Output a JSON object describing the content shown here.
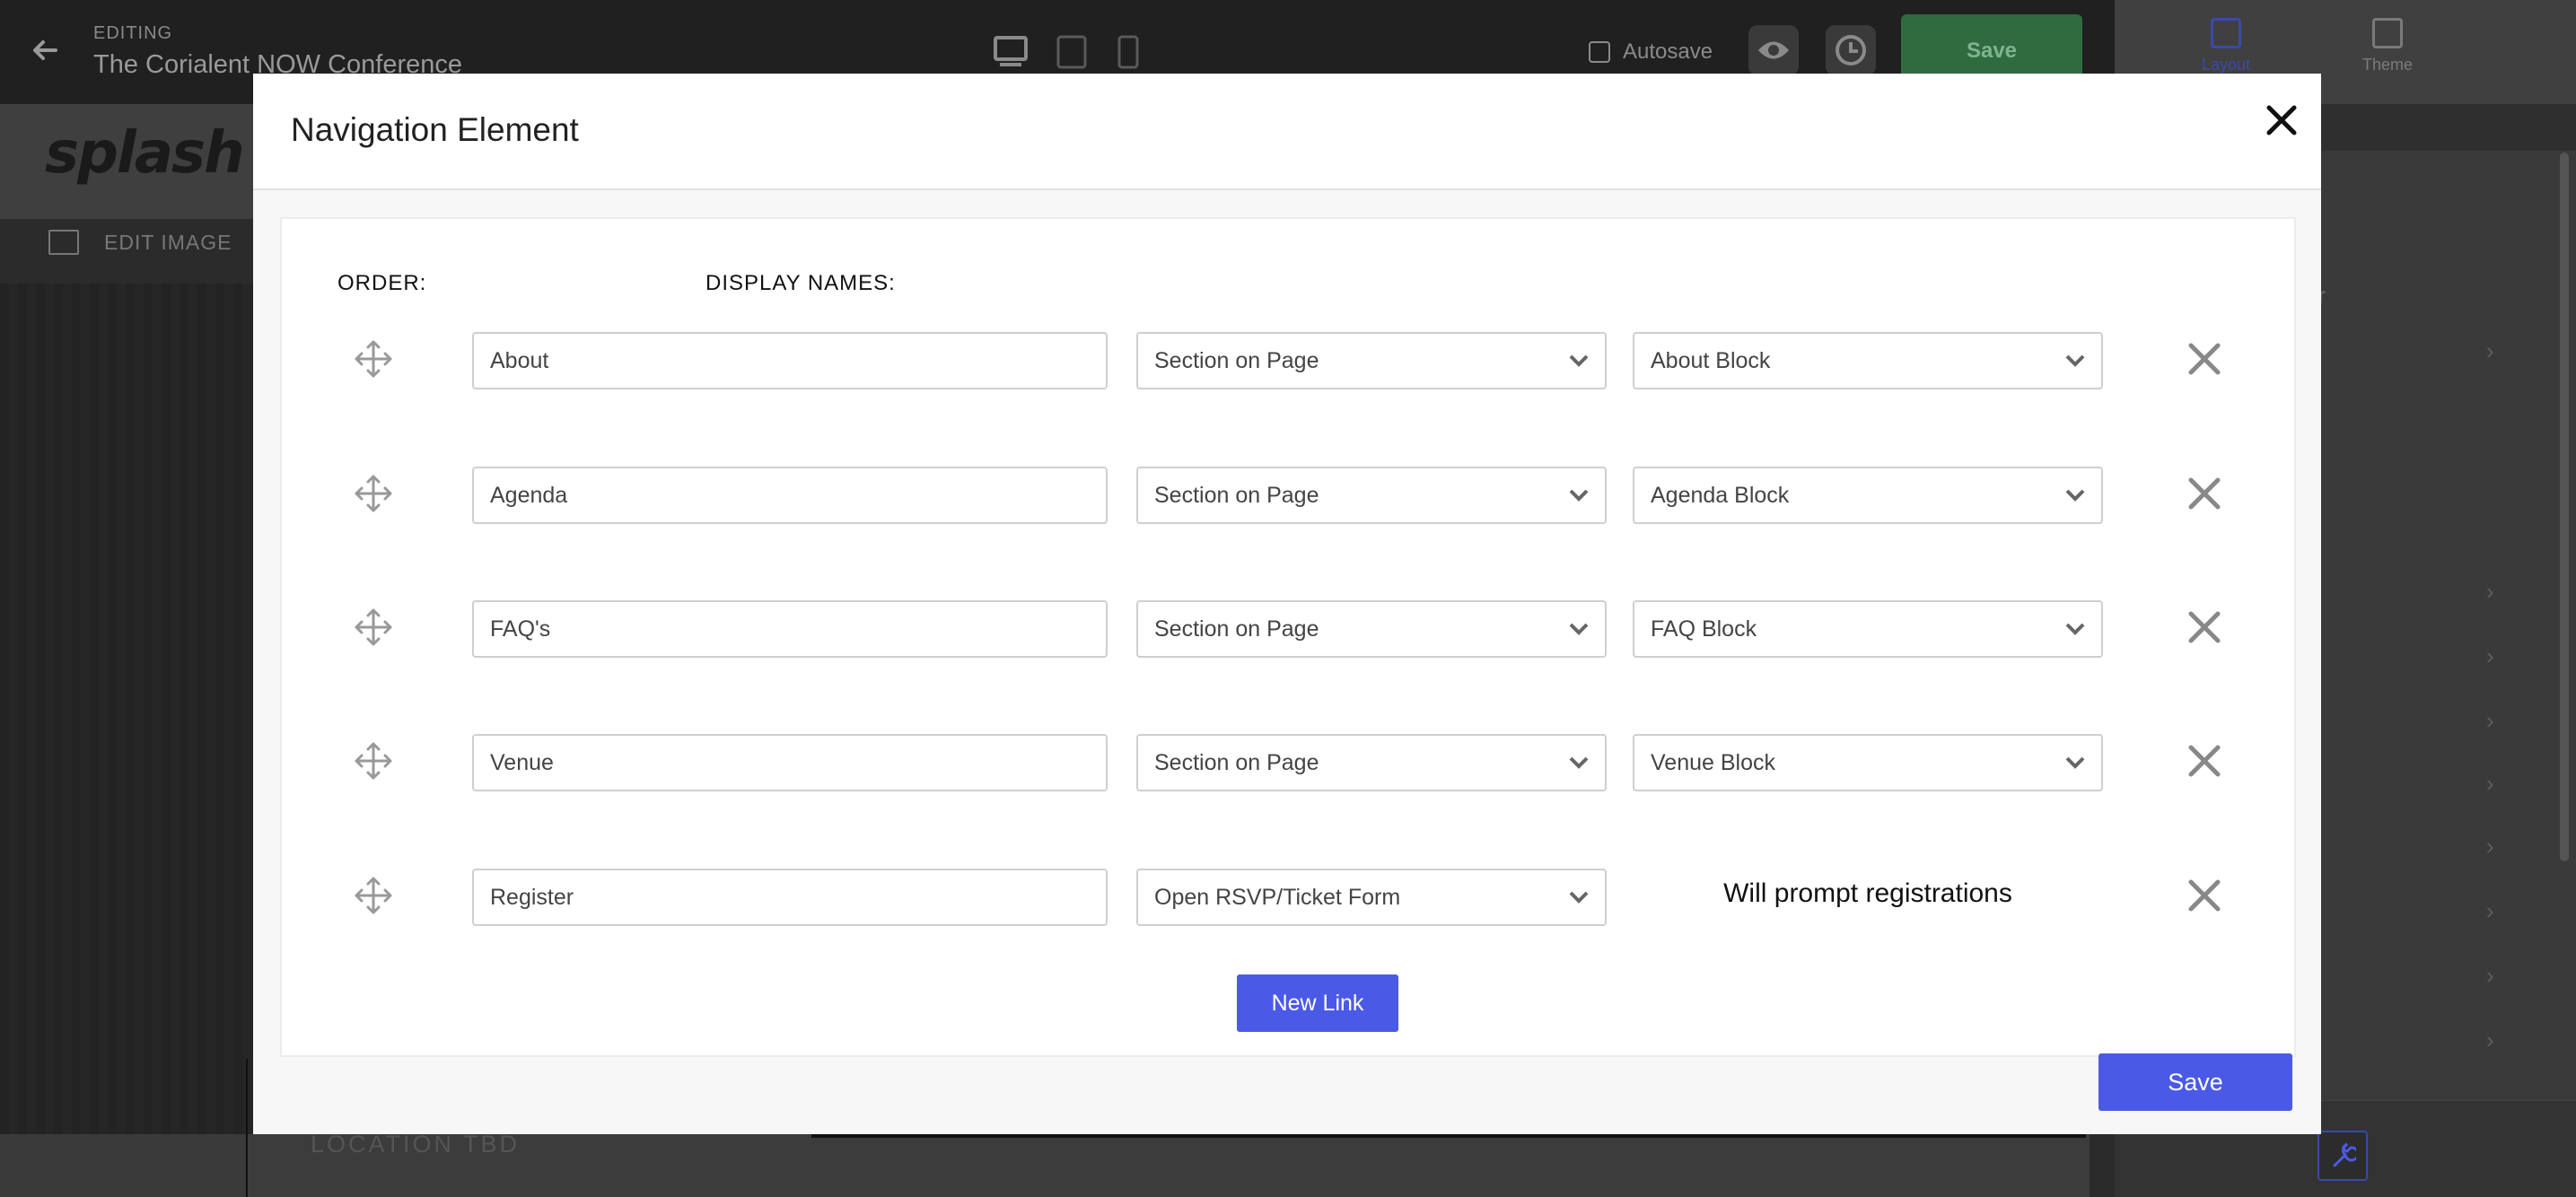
{
  "editor": {
    "editing_label": "EDITING",
    "document_title": "The Corialent NOW Conference",
    "autosave_label": "Autosave",
    "save_label": "Save",
    "brand_logo": "splash",
    "edit_image_label": "EDIT IMAGE",
    "location_text": "LOCATION TBD"
  },
  "right_panel": {
    "tabs": [
      {
        "label": "Layout",
        "active": true
      },
      {
        "label": "Theme",
        "active": false
      }
    ],
    "partial_text_1": "er",
    "partial_text_2": "r"
  },
  "modal": {
    "title": "Navigation Element",
    "order_header": "ORDER:",
    "display_names_header": "DISPLAY NAMES:",
    "rows": [
      {
        "name": "About",
        "link_type": "Section on Page",
        "target": "About Block"
      },
      {
        "name": "Agenda",
        "link_type": "Section on Page",
        "target": "Agenda Block"
      },
      {
        "name": "FAQ's",
        "link_type": "Section on Page",
        "target": "FAQ Block"
      },
      {
        "name": "Venue",
        "link_type": "Section on Page",
        "target": "Venue Block"
      },
      {
        "name": "Register",
        "link_type": "Open RSVP/Ticket Form",
        "note": "Will prompt registrations"
      }
    ],
    "new_link_label": "New Link",
    "save_label": "Save"
  },
  "colors": {
    "primary": "#4b5ae6",
    "success_dimmed": "#2f6b3f",
    "layout_tab_active": "#3a4aa8"
  },
  "icons": [
    "back-arrow-icon",
    "desktop-icon",
    "tablet-icon",
    "mobile-icon",
    "eye-icon",
    "history-icon",
    "close-icon",
    "move-icon",
    "chevron-down-icon",
    "remove-icon",
    "wrench-icon",
    "image-icon"
  ]
}
